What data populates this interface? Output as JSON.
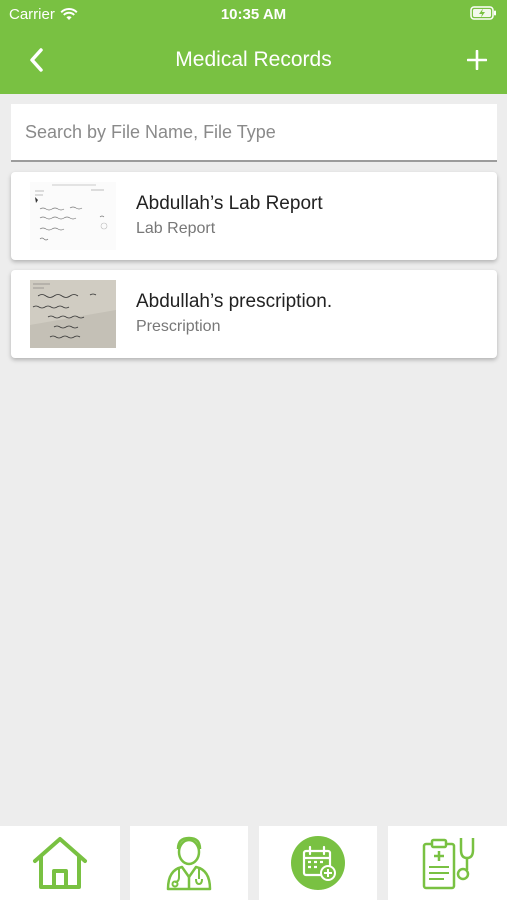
{
  "status_bar": {
    "carrier": "Carrier",
    "time": "10:35 AM"
  },
  "nav": {
    "title": "Medical Records",
    "back_icon": "chevron-left-icon",
    "add_icon": "plus-icon"
  },
  "search": {
    "placeholder": "Search by File Name, File Type",
    "value": ""
  },
  "records": [
    {
      "title": "Abdullah’s Lab Report",
      "type": "Lab Report"
    },
    {
      "title": "Abdullah’s prescription.",
      "type": "Prescription"
    }
  ],
  "tabs": [
    {
      "icon": "home-icon"
    },
    {
      "icon": "doctor-icon"
    },
    {
      "icon": "calendar-add-icon"
    },
    {
      "icon": "clipboard-stethoscope-icon"
    }
  ],
  "colors": {
    "accent": "#79c142",
    "background": "#ededed"
  }
}
